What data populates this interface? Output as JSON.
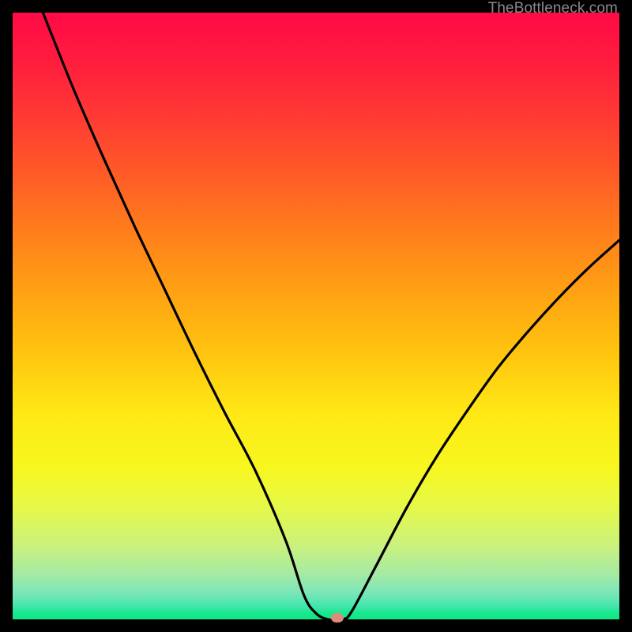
{
  "watermark": {
    "text": "TheBottleneck.com"
  },
  "chart_data": {
    "type": "line",
    "title": "",
    "xlabel": "",
    "ylabel": "",
    "ylim": [
      0,
      100
    ],
    "xlim": [
      0,
      100
    ],
    "legend": null,
    "grid": false,
    "series": [
      {
        "name": "curve",
        "x": [
          5,
          10,
          15,
          20,
          25,
          30,
          35,
          40,
          45,
          48,
          50,
          52,
          54.5,
          56,
          60,
          65,
          70,
          75,
          80,
          85,
          90,
          95,
          100
        ],
        "y": [
          100,
          87.5,
          76,
          65,
          54.5,
          44,
          34,
          24.5,
          13,
          4,
          1,
          0,
          0,
          1.5,
          9,
          18.5,
          27,
          34.5,
          41.5,
          47.5,
          53,
          58,
          62.5
        ]
      }
    ],
    "annotations": [
      {
        "name": "minimum-marker",
        "x": 53.5,
        "y": 0,
        "color": "#e08a78"
      }
    ],
    "background_gradient": {
      "direction": "vertical",
      "stops": [
        {
          "pos": 0.0,
          "color": "#ff0a46"
        },
        {
          "pos": 0.25,
          "color": "#ff5529"
        },
        {
          "pos": 0.55,
          "color": "#ffc40f"
        },
        {
          "pos": 0.8,
          "color": "#e4f84d"
        },
        {
          "pos": 0.96,
          "color": "#7de6b8"
        },
        {
          "pos": 1.0,
          "color": "#10e786"
        }
      ]
    }
  }
}
